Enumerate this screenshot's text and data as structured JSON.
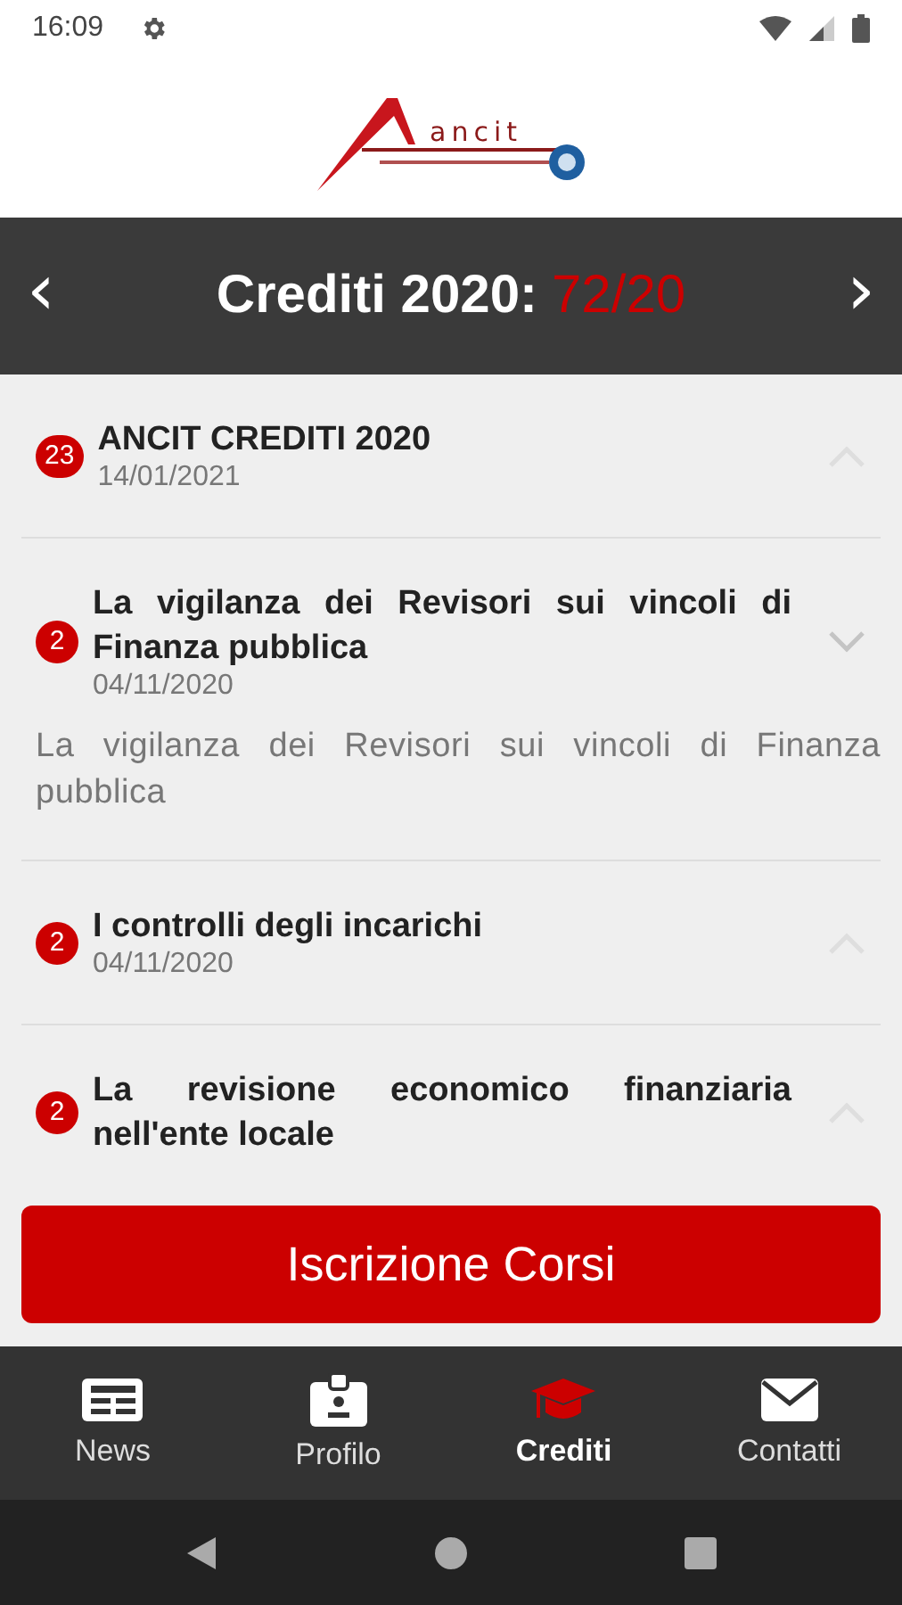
{
  "status_bar": {
    "time": "16:09"
  },
  "logo": {
    "text": "ancit"
  },
  "header": {
    "prev": "‹",
    "title": "Crediti 2020:",
    "score": "72/20",
    "next": "›"
  },
  "courses": [
    {
      "count": "23",
      "title": "ANCIT CREDITI 2020",
      "date": "14/01/2021",
      "expanded": false
    },
    {
      "count": "2",
      "title": "La vigilanza dei Revisori sui vincoli di Finanza pubblica",
      "date": "04/11/2020",
      "expanded": true,
      "description": "La vigilanza dei Revisori sui vincoli di Finanza pubblica"
    },
    {
      "count": "2",
      "title": "I controlli degli incarichi",
      "date": "04/11/2020",
      "expanded": false
    },
    {
      "count": "2",
      "title": "La revisione economico finanziaria nell'ente locale",
      "expanded": false
    }
  ],
  "action_button": "Iscrizione Corsi",
  "bottom_nav": [
    {
      "label": "News",
      "kind": "news",
      "selected": false
    },
    {
      "label": "Profilo",
      "kind": "badge",
      "selected": false
    },
    {
      "label": "Crediti",
      "kind": "cap",
      "selected": true
    },
    {
      "label": "Contatti",
      "kind": "mail",
      "selected": false
    }
  ]
}
